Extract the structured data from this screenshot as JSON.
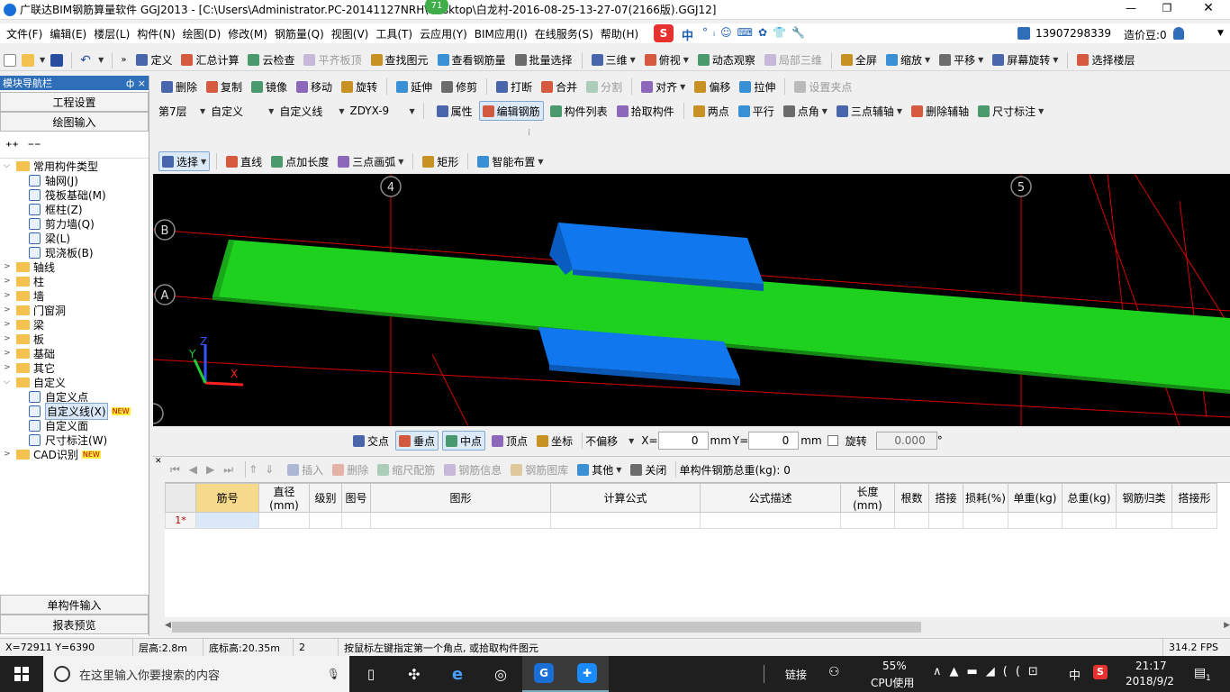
{
  "title": {
    "app_title": "广联达BIM钢筋算量软件 GGJ2013 - [C:\\Users\\Administrator.PC-20141127NRH\\Desktop\\白龙村-2016-08-25-13-27-07(2166版).GGJ12]",
    "badge": "71"
  },
  "menu": {
    "items": [
      "文件(F)",
      "编辑(E)",
      "楼层(L)",
      "构件(N)",
      "绘图(D)",
      "修改(M)",
      "钢筋量(Q)",
      "视图(V)",
      "工具(T)",
      "云应用(Y)",
      "BIM应用(I)",
      "在线服务(S)",
      "帮助(H)"
    ],
    "ime": "中",
    "user": "13907298339",
    "price": "造价豆:0"
  },
  "toolbar1": {
    "items": [
      "定义",
      "汇总计算",
      "云检查",
      "平齐板顶",
      "查找图元",
      "查看钢筋量",
      "批量选择",
      "三维",
      "俯视",
      "动态观察",
      "局部三维",
      "全屏",
      "缩放",
      "平移",
      "屏幕旋转",
      "选择楼层"
    ]
  },
  "toolbar2": {
    "items": [
      "删除",
      "复制",
      "镜像",
      "移动",
      "旋转",
      "延伸",
      "修剪",
      "打断",
      "合并",
      "分割",
      "对齐",
      "偏移",
      "拉伸",
      "设置夹点"
    ]
  },
  "toolbar3": {
    "floor": "第7层",
    "type": "自定义",
    "subtype": "自定义线",
    "code": "ZDYX-9",
    "items": [
      "属性",
      "编辑钢筋",
      "构件列表",
      "拾取构件",
      "两点",
      "平行",
      "点角",
      "三点辅轴",
      "删除辅轴",
      "尺寸标注"
    ]
  },
  "toolbar4": {
    "items": [
      "选择",
      "直线",
      "点加长度",
      "三点画弧",
      "矩形",
      "智能布置"
    ]
  },
  "nav": {
    "header": "模块导航栏",
    "pin": "ф ×",
    "btn_project": "工程设置",
    "btn_draw": "绘图输入",
    "btn_single": "单构件输入",
    "btn_report": "报表预览",
    "tree": [
      {
        "label": "常用构件类型",
        "level": 0,
        "exp": "⌵",
        "folder": true
      },
      {
        "label": "轴网(J)",
        "level": 2
      },
      {
        "label": "筏板基础(M)",
        "level": 2
      },
      {
        "label": "框柱(Z)",
        "level": 2
      },
      {
        "label": "剪力墙(Q)",
        "level": 2
      },
      {
        "label": "梁(L)",
        "level": 2
      },
      {
        "label": "现浇板(B)",
        "level": 2
      },
      {
        "label": "轴线",
        "level": 0,
        "exp": ">",
        "folder": true
      },
      {
        "label": "柱",
        "level": 0,
        "exp": ">",
        "folder": true
      },
      {
        "label": "墙",
        "level": 0,
        "exp": ">",
        "folder": true
      },
      {
        "label": "门窗洞",
        "level": 0,
        "exp": ">",
        "folder": true
      },
      {
        "label": "梁",
        "level": 0,
        "exp": ">",
        "folder": true
      },
      {
        "label": "板",
        "level": 0,
        "exp": ">",
        "folder": true
      },
      {
        "label": "基础",
        "level": 0,
        "exp": ">",
        "folder": true
      },
      {
        "label": "其它",
        "level": 0,
        "exp": ">",
        "folder": true
      },
      {
        "label": "自定义",
        "level": 0,
        "exp": "⌵",
        "folder": true
      },
      {
        "label": "自定义点",
        "level": 2
      },
      {
        "label": "自定义线(X)",
        "level": 2,
        "selected": true,
        "tag": "NEW"
      },
      {
        "label": "自定义面",
        "level": 2
      },
      {
        "label": "尺寸标注(W)",
        "level": 2
      },
      {
        "label": "CAD识别",
        "level": 0,
        "exp": ">",
        "folder": true,
        "tag": "NEW"
      }
    ]
  },
  "canvas": {
    "axis_labels": [
      "4",
      "5",
      "B",
      "A"
    ],
    "axis_x": "X",
    "axis_y": "Y",
    "axis_z": "Z"
  },
  "snap": {
    "items": [
      "交点",
      "垂点",
      "中点",
      "顶点",
      "坐标"
    ],
    "offset": "不偏移",
    "x_label": "X=",
    "x_value": "0",
    "y_label": "Y=",
    "y_value": "0",
    "unit": "mm",
    "rotate_label": "旋转",
    "rotate_value": "0.000",
    "degree": "°"
  },
  "gridtool": {
    "items": [
      "插入",
      "删除",
      "缩尺配筋",
      "钢筋信息",
      "钢筋图库",
      "其他",
      "关闭"
    ],
    "total": "单构件钢筋总重(kg): 0"
  },
  "grid": {
    "columns": [
      "筋号",
      "直径(mm)",
      "级别",
      "图号",
      "图形",
      "计算公式",
      "公式描述",
      "长度(mm)",
      "根数",
      "搭接",
      "损耗(%)",
      "单重(kg)",
      "总重(kg)",
      "钢筋归类",
      "搭接形"
    ],
    "row_num": "1*"
  },
  "status": {
    "coords": "X=72911 Y=6390",
    "floor_h": "层高:2.8m",
    "bottom_h": "底标高:20.35m",
    "num": "2",
    "hint": "按鼠标左键指定第一个角点, 或拾取构件图元",
    "fps": "314.2 FPS"
  },
  "taskbar": {
    "search": "在这里输入你要搜索的内容",
    "link": "链接",
    "cpu_pct": "55%",
    "cpu_label": "CPU使用",
    "ime": "中",
    "time": "21:17",
    "date": "2018/9/2",
    "notif": "1"
  },
  "colors": {
    "accent": "#2f6fba",
    "beam_green": "#1fd11f",
    "block_blue": "#1177ee",
    "axis_red": "#d80000"
  }
}
